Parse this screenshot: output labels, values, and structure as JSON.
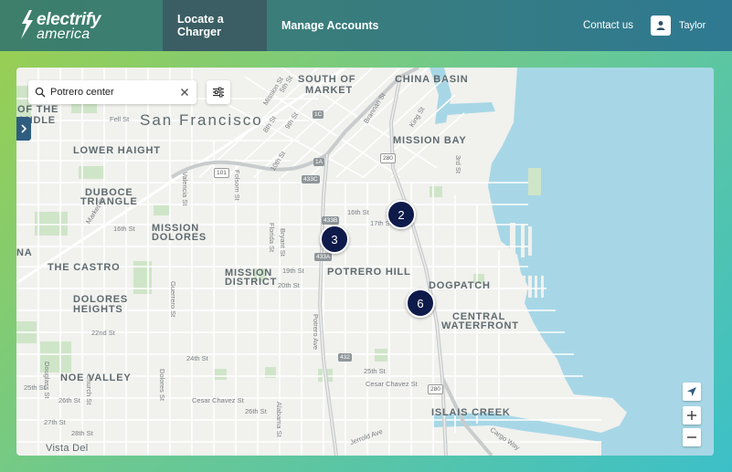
{
  "brand": {
    "line1": "electrify",
    "line2": "america"
  },
  "nav": {
    "locate_label": "Locate a Charger",
    "manage_label": "Manage Accounts",
    "contact_label": "Contact us"
  },
  "user": {
    "name": "Taylor",
    "icon": "person-icon"
  },
  "search": {
    "value": "Potrero center",
    "icon": "search-icon"
  },
  "filter": {
    "icon": "sliders-icon"
  },
  "map": {
    "city": "San Francisco",
    "neighborhoods": {
      "south_of_market_1": "SOUTH OF",
      "south_of_market_2": "MARKET",
      "china_basin": "CHINA BASIN",
      "of_the": "OF THE",
      "andle": "ANDLE",
      "lower_haight": "LOWER HAIGHT",
      "mission_bay": "MISSION BAY",
      "duboce_1": "DUBOCE",
      "duboce_2": "TRIANGLE",
      "mission_dolores_1": "MISSION",
      "mission_dolores_2": "DOLORES",
      "the_castro": "THE CASTRO",
      "potrero_hill": "POTRERO HILL",
      "mission_district_1": "MISSION",
      "mission_district_2": "DISTRICT",
      "dogpatch": "DOGPATCH",
      "dolores_heights_1": "DOLORES",
      "dolores_heights_2": "HEIGHTS",
      "central_wf_1": "CENTRAL",
      "central_wf_2": "WATERFRONT",
      "noe_valley": "NOE VALLEY",
      "islais_creek": "ISLAIS CREEK",
      "vista_del": "Vista Del",
      "na": "NA"
    },
    "streets": {
      "fell": "Fell St",
      "mission": "Mission St",
      "fifth": "5th St",
      "eighth": "8th St",
      "ninth": "9th St",
      "tenth": "10th St",
      "brannan": "Brannan St",
      "king": "King St",
      "third": "3rd St",
      "sixteenth": "16th St",
      "seventeenth": "17th St",
      "valencia": "Valencia St",
      "folsom": "Folsom St",
      "market": "Market St",
      "sixteenth_w": "16th St",
      "bryant": "Bryant St",
      "florida": "Florida St",
      "nineteenth": "19th St",
      "twentieth": "20th St",
      "twenty_second": "22nd St",
      "guerrero": "Guerrero St",
      "potrero": "Potrero Ave",
      "twenty_fourth": "24th St",
      "twenty_fifth_w": "25th St",
      "twenty_sixth": "26th St",
      "dolores": "Dolores St",
      "cesar_w": "Cesar Chavez St",
      "cesar_e": "Cesar Chavez St",
      "twenty_fifth": "25th St",
      "church": "Church St",
      "douglass": "Douglass St",
      "alabama": "Alabama St",
      "jerrold": "Jerrold Ave",
      "cargo": "Cargo Way",
      "twenty_seventh": "27th St",
      "twenty_eighth": "28th St",
      "twenty_sixth_w": "26th St"
    },
    "shields": {
      "s1c": "1C",
      "s1a": "1A",
      "s433c": "433C",
      "s433b": "433B",
      "s433a": "433A",
      "s101": "101",
      "s280a": "280",
      "s280b": "280",
      "s432": "432"
    },
    "clusters": [
      {
        "count": "2"
      },
      {
        "count": "3"
      },
      {
        "count": "6"
      }
    ]
  },
  "controls": {
    "locate_icon": "location-arrow-icon",
    "zoom_in_icon": "plus-icon",
    "zoom_out_icon": "minus-icon",
    "panel_icon": "chevron-right-icon",
    "clear_icon": "close-icon"
  },
  "colors": {
    "header": "#3a7d7a",
    "active_nav": "#3a5e64",
    "cluster": "#0e1a4a",
    "water": "#9fd3e3",
    "panel_toggle": "#2f5d80"
  }
}
